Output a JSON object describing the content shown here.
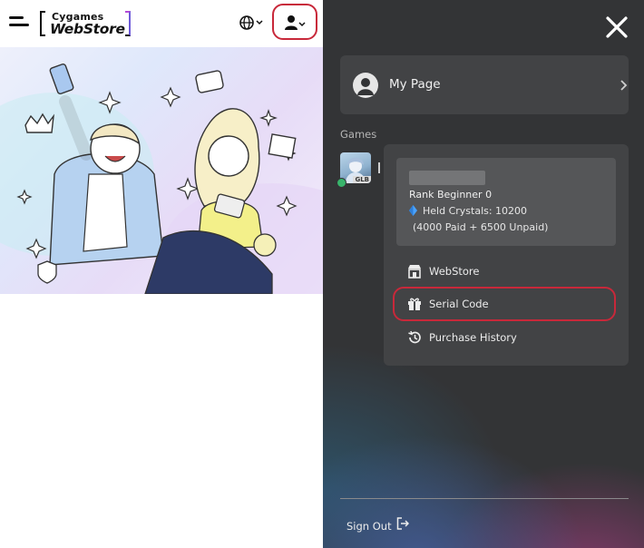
{
  "header": {
    "logo_top": "Cygames",
    "logo_bottom": "WebStore"
  },
  "menu": {
    "my_page_label": "My Page",
    "games_label": "Games",
    "game": {
      "region_badge": "GLB",
      "rank": "Rank Beginner 0",
      "held_crystals": "Held Crystals: 10200",
      "crystal_breakdown": "(4000 Paid + 6500 Unpaid)"
    },
    "items": [
      {
        "label": "WebStore",
        "icon": "store-icon"
      },
      {
        "label": "Serial Code",
        "icon": "gift-icon"
      },
      {
        "label": "Purchase History",
        "icon": "history-icon"
      }
    ],
    "sign_out_label": "Sign Out"
  },
  "colors": {
    "highlight": "#c8283a",
    "panel_bg": "#333436",
    "card_bg": "#424345",
    "crystal": "#4aa3ff"
  }
}
